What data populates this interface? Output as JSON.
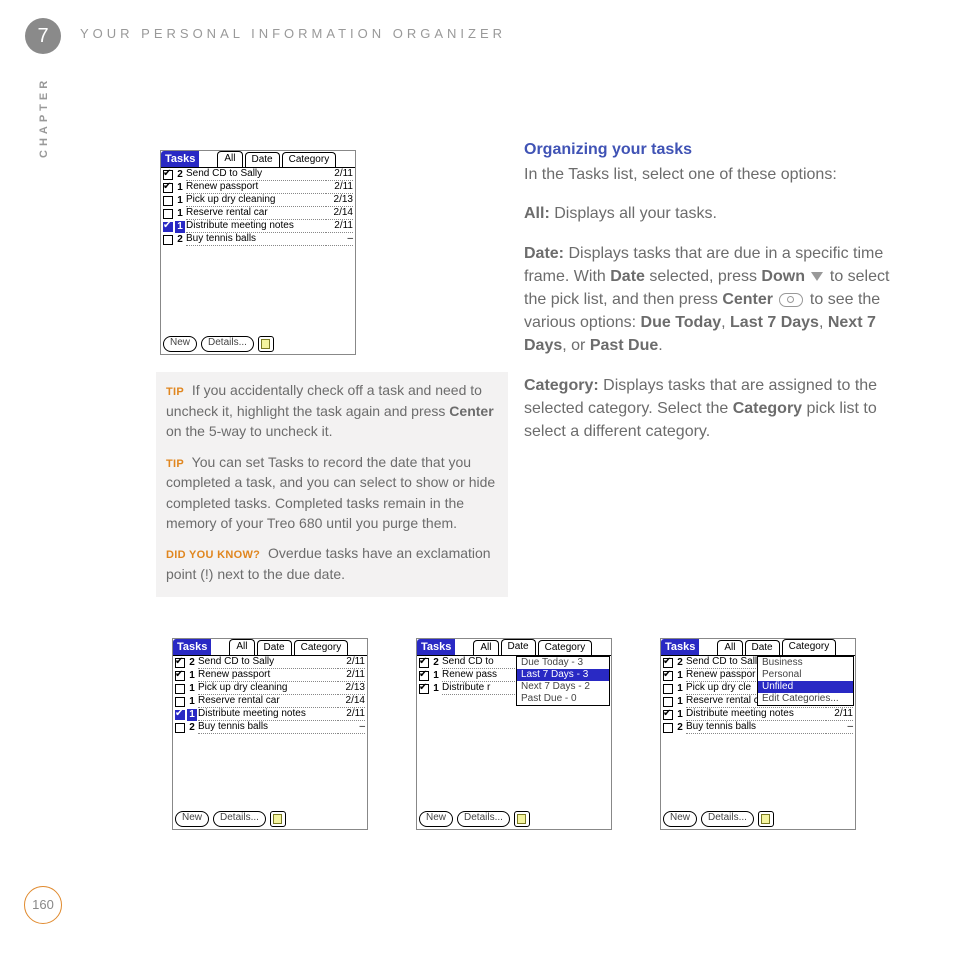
{
  "header": {
    "chapter_number": "7",
    "chapter_title": "YOUR PERSONAL INFORMATION ORGANIZER",
    "side_label": "CHAPTER",
    "page_number": "160"
  },
  "body": {
    "heading": "Organizing your tasks",
    "intro": "In the Tasks list, select one of these options:",
    "all_label": "All:",
    "all_text": " Displays all your tasks.",
    "date_label": "Date:",
    "date_text_1": " Displays tasks that are due in a specific time frame. With ",
    "date_bold_1": "Date",
    "date_text_2": " selected, press ",
    "date_bold_2": "Down",
    "date_text_3": " to select the pick list, and then press ",
    "date_bold_3": "Center",
    "date_text_4": " to see the various options: ",
    "date_bold_4": "Due Today",
    "date_text_5": ", ",
    "date_bold_5": "Last 7 Days",
    "date_text_6": ", ",
    "date_bold_6": "Next 7 Days",
    "date_text_7": ", or ",
    "date_bold_7": "Past Due",
    "date_text_8": ".",
    "cat_label": "Category:",
    "cat_text_1": " Displays tasks that are assigned to the selected category. Select the ",
    "cat_bold_1": "Category",
    "cat_text_2": " pick list to select a different category."
  },
  "tips": {
    "tip_label": "TIP",
    "dyk_label": "DID YOU KNOW?",
    "tip1_a": "If you accidentally check off a task and need to uncheck it, highlight the task again and press ",
    "tip1_bold": "Center",
    "tip1_b": " on the 5-way to uncheck it.",
    "tip2": "You can set Tasks to record the date that you completed a task, and you can select to show or hide completed tasks. Completed tasks remain in the memory of your Treo 680 until you purge them.",
    "dyk": "Overdue tasks have an exclamation point (!) next to the due date."
  },
  "palm": {
    "title": "Tasks",
    "tabs": {
      "all": "All",
      "date": "Date",
      "category": "Category"
    },
    "buttons": {
      "new": "New",
      "details": "Details..."
    },
    "tasks_full": [
      {
        "checked": true,
        "prio": "2",
        "desc": "Send CD to Sally",
        "date": "2/11",
        "highlight": false
      },
      {
        "checked": true,
        "prio": "1",
        "desc": "Renew passport",
        "date": "2/11",
        "highlight": false
      },
      {
        "checked": false,
        "prio": "1",
        "desc": "Pick up dry cleaning",
        "date": "2/13",
        "highlight": false
      },
      {
        "checked": false,
        "prio": "1",
        "desc": "Reserve rental car",
        "date": "2/14",
        "highlight": false
      },
      {
        "checked": true,
        "prio": "1",
        "desc": "Distribute meeting notes",
        "date": "2/11",
        "highlight": true
      },
      {
        "checked": false,
        "prio": "2",
        "desc": "Buy tennis balls",
        "date": "–",
        "highlight": false
      }
    ],
    "tasks_date_filtered": [
      {
        "checked": true,
        "prio": "2",
        "desc": "Send CD to",
        "date": "",
        "highlight": false
      },
      {
        "checked": true,
        "prio": "1",
        "desc": "Renew pass",
        "date": "",
        "highlight": false
      },
      {
        "checked": true,
        "prio": "1",
        "desc": "Distribute r",
        "date": "",
        "highlight": false
      }
    ],
    "date_dropdown": [
      "Due Today - 3",
      "Last 7 Days - 3",
      "Next 7 Days - 2",
      "Past Due - 0"
    ],
    "date_dropdown_selected": 1,
    "tasks_cat_truncated": [
      {
        "checked": true,
        "prio": "2",
        "desc": "Send CD to Sall",
        "date": "",
        "highlight": false
      },
      {
        "checked": true,
        "prio": "1",
        "desc": "Renew passpor",
        "date": "",
        "highlight": false
      },
      {
        "checked": false,
        "prio": "1",
        "desc": "Pick up dry cle",
        "date": "",
        "highlight": false
      },
      {
        "checked": false,
        "prio": "1",
        "desc": "Reserve rental car",
        "date": "2/14",
        "highlight": false
      },
      {
        "checked": true,
        "prio": "1",
        "desc": "Distribute meeting notes",
        "date": "2/11",
        "highlight": false
      },
      {
        "checked": false,
        "prio": "2",
        "desc": "Buy tennis balls",
        "date": "–",
        "highlight": false
      }
    ],
    "category_dropdown": [
      "Business",
      "Personal",
      "Unfiled",
      "Edit Categories..."
    ],
    "category_dropdown_selected": 2
  }
}
